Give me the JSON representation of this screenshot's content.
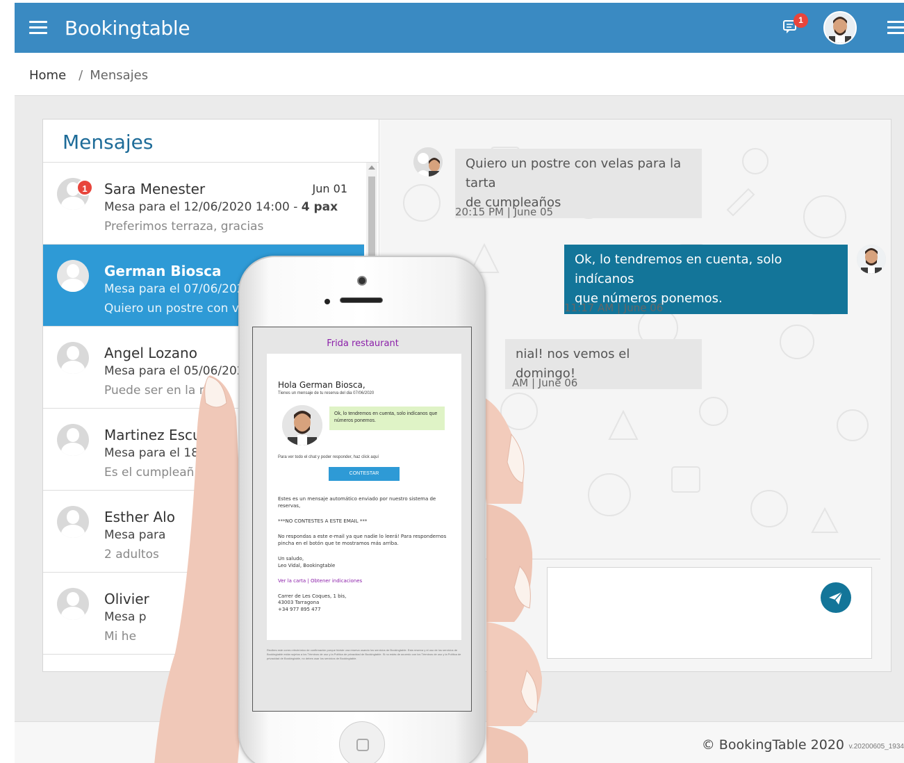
{
  "app": {
    "brand": "Bookingtable",
    "notification_count": "1"
  },
  "breadcrumb": {
    "home": "Home",
    "separator": "/",
    "current": "Mensajes"
  },
  "messages_panel": {
    "title": "Mensajes",
    "conversations": [
      {
        "name": "Sara Menester",
        "date": "Jun 01",
        "line1": "Mesa para el 12/06/2020 14:00 - ",
        "pax": "4 pax",
        "line2": "Preferimos terraza, gracias",
        "badge": "1"
      },
      {
        "name": "German Biosca",
        "line1": "Mesa para el 07/06/202",
        "line2": "Quiero un postre con ve"
      },
      {
        "name": "Angel Lozano",
        "line1": "Mesa para el 05/06/202",
        "line2": "Puede ser en la m"
      },
      {
        "name": "Martinez Escud",
        "line1": "Mesa para el 18/",
        "line2": "Es el cumpleañ"
      },
      {
        "name": "Esther Alo",
        "line1": "Mesa para",
        "line2": "2 adultos"
      },
      {
        "name": "Olivier",
        "line1": "Mesa p",
        "line2": "Mi he"
      }
    ]
  },
  "chat": {
    "messages": [
      {
        "direction": "in",
        "text_line1": "Quiero un postre con velas para la tarta",
        "text_line2": "de cumpleaños",
        "time": "20:15 PM | June 05"
      },
      {
        "direction": "out",
        "text_line1": "Ok, lo tendremos en cuenta, solo indícanos",
        "text_line2": "que números ponemos.",
        "time": "11:17 AM | June 06"
      },
      {
        "direction": "in",
        "text_line1": "nial! nos vemos el domingo!",
        "time": "AM | June 06"
      }
    ]
  },
  "phone_email": {
    "restaurant": "Frida restaurant",
    "greeting": "Hola German Biosca,",
    "subtitle": "Tienes un mensaje de tu reserva del dia 07/06/2020",
    "bubble": "Ok, lo tendremos en cuenta, solo indícanos que números ponemos.",
    "view_chat": "Para ver todo el chat y poder responder, haz click aquí",
    "reply_button": "CONTESTAR",
    "auto_msg": "Estes es un mensaje automático enviado por nuestro sistema de reservas,",
    "no_reply": "***NO CONTESTES A ESTE EMAIL ***",
    "no_reply_body": "No respondas a este e-mail ya que nadie lo leerá! Para respondernos pincha en el botón que te mostramos más arriba.",
    "sign1": "Un saludo,",
    "sign2": "Leo Vidal, Bookingtable",
    "links": "Ver la carta | Obtener indicaciones",
    "addr1": "Carrer de Les Coques, 1 bis,",
    "addr2": "43003 Tarragona",
    "phone": "+34 977 895 477",
    "legal": "Recibes este correo electrónico de confirmación porque hiciste una reserva usando los servicios de Bookingtable. Esta reserva y el uso de los servicios de Bookingtable están sujetos a los Términos de uso y la Política de privacidad de Bookingtable. Si no estás de acuerdo con los Términos de uso y la Política de privacidad de Bookingtable, no debes usar los servicios de Bookingtable."
  },
  "footer": {
    "copyright": "© BookingTable 2020",
    "version": "v.20200605_1934"
  },
  "colors": {
    "topbar": "#3a8ac2",
    "active_row": "#2e9ad6",
    "outgoing_bubble": "#137599",
    "badge": "#e8453c",
    "restaurant_name": "#8b1fa9"
  }
}
